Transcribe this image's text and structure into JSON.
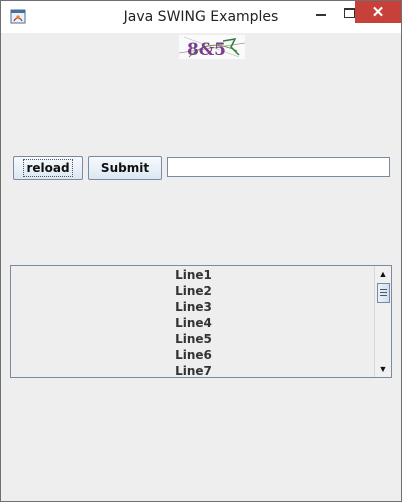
{
  "window": {
    "title": "Java SWING Examples",
    "close_glyph": "✕"
  },
  "captcha": {
    "text": "8&5"
  },
  "buttons": {
    "reload": "reload",
    "submit": "Submit"
  },
  "input": {
    "value": ""
  },
  "list": {
    "items": [
      "Line1",
      "Line2",
      "Line3",
      "Line4",
      "Line5",
      "Line6",
      "Line7"
    ]
  },
  "scrollbar": {
    "up_glyph": "▲",
    "down_glyph": "▼"
  }
}
